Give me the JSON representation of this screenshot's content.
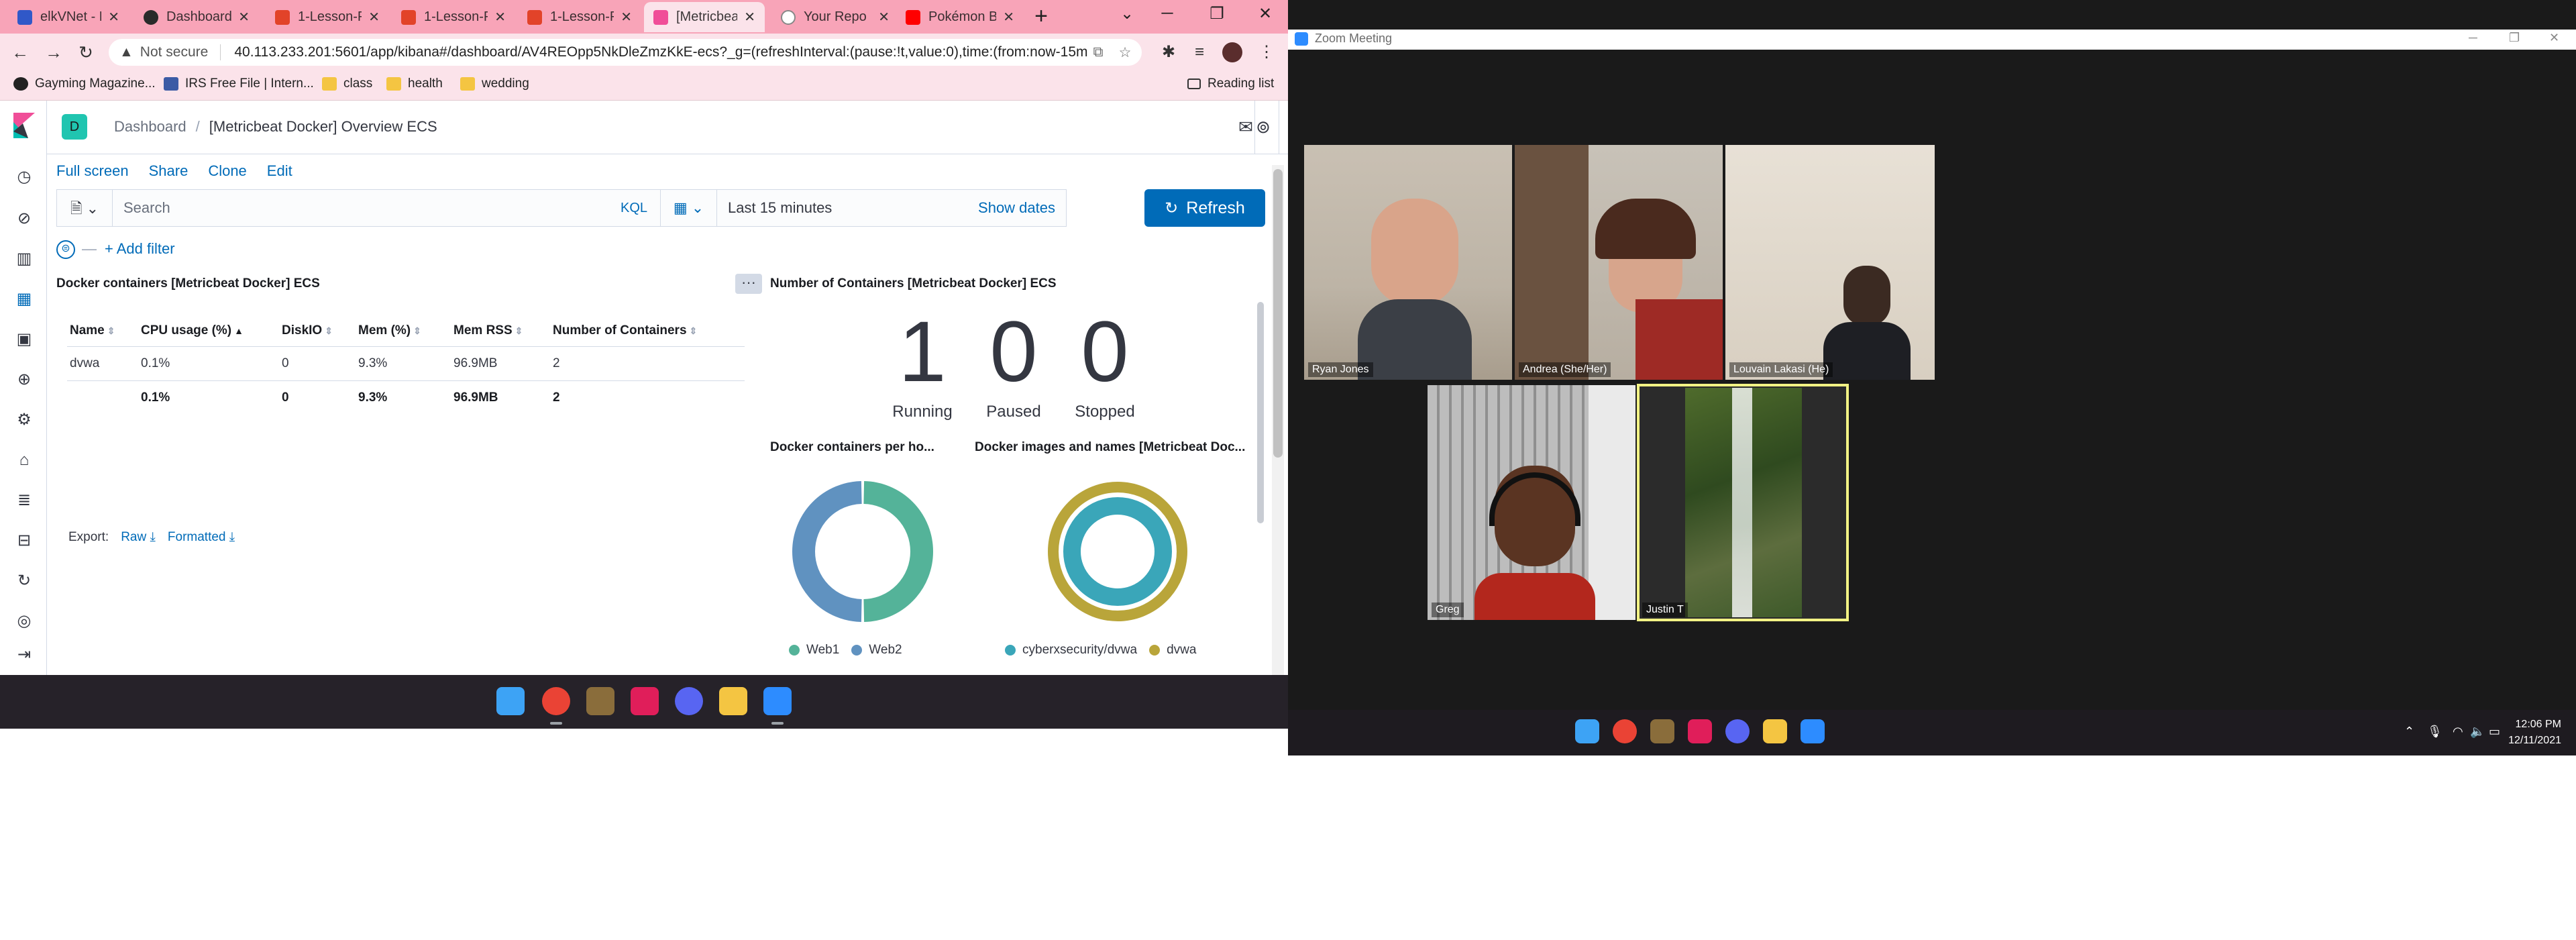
{
  "browser": {
    "tabs": [
      {
        "label": "elkVNet - M",
        "color": "#3058c8"
      },
      {
        "label": "Dashboard",
        "color": "#2a2a2a"
      },
      {
        "label": "1-Lesson-P",
        "color": "#e24329"
      },
      {
        "label": "1-Lesson-P",
        "color": "#e24329"
      },
      {
        "label": "1-Lesson-P",
        "color": "#e24329"
      },
      {
        "label": "[Metricbeat",
        "color": "#f04e98"
      },
      {
        "label": "Your Repo",
        "color": "#888888"
      },
      {
        "label": "Pokémon B",
        "color": "#ff0000"
      }
    ],
    "new_tab": "+",
    "address": {
      "not_secure": "Not secure",
      "url": "40.113.233.201:5601/app/kibana#/dashboard/AV4REOpp5NkDleZmzKkE-ecs?_g=(refreshInterval:(pause:!t,value:0),time:(from:now-15m,..."
    },
    "bookmarks": [
      {
        "label": "Gayming Magazine..."
      },
      {
        "label": "IRS Free File | Intern..."
      },
      {
        "label": "class"
      },
      {
        "label": "health"
      },
      {
        "label": "wedding"
      }
    ],
    "reading_list": "Reading list"
  },
  "kibana": {
    "space_badge": "D",
    "breadcrumbs": [
      "Dashboard",
      "[Metricbeat Docker] Overview ECS"
    ],
    "top_nav": [
      "Full screen",
      "Share",
      "Clone",
      "Edit"
    ],
    "search": {
      "placeholder": "Search",
      "language": "KQL"
    },
    "date": {
      "value": "Last 15 minutes",
      "show_dates": "Show dates"
    },
    "refresh_label": "Refresh",
    "add_filter": "+ Add filter",
    "containers_panel": {
      "title": "Docker containers [Metricbeat Docker] ECS",
      "columns": [
        "Name",
        "CPU usage (%)",
        "DiskIO",
        "Mem (%)",
        "Mem RSS",
        "Number of Containers"
      ],
      "rows": [
        [
          "dvwa",
          "0.1%",
          "0",
          "9.3%",
          "96.9MB",
          "2"
        ]
      ],
      "totals": [
        "",
        "0.1%",
        "0",
        "9.3%",
        "96.9MB",
        "2"
      ],
      "export_label": "Export:",
      "export_raw": "Raw",
      "export_formatted": "Formatted"
    },
    "count_panel": {
      "title": "Number of Containers [Metricbeat Docker] ECS",
      "metrics": [
        {
          "value": "1",
          "label": "Running"
        },
        {
          "value": "0",
          "label": "Paused"
        },
        {
          "value": "0",
          "label": "Stopped"
        }
      ]
    },
    "donut1": {
      "title": "Docker containers per ho...",
      "legend": [
        {
          "label": "Web1",
          "color": "#54b399"
        },
        {
          "label": "Web2",
          "color": "#6092c0"
        }
      ]
    },
    "donut2": {
      "title": "Docker images and names [Metricbeat Doc...",
      "legend": [
        {
          "label": "cyberxsecurity/dvwa",
          "color": "#3aa6b9"
        },
        {
          "label": "dvwa",
          "color": "#b9a53a"
        }
      ]
    }
  },
  "chart_data": [
    {
      "type": "pie",
      "title": "Docker containers per ho...",
      "categories": [
        "Web1",
        "Web2"
      ],
      "values": [
        50,
        50
      ],
      "colors": [
        "#54b399",
        "#6092c0"
      ]
    },
    {
      "type": "pie",
      "title": "Docker images and names [Metricbeat Doc...",
      "categories": [
        "cyberxsecurity/dvwa",
        "dvwa"
      ],
      "values": [
        100,
        100
      ],
      "colors": [
        "#3aa6b9",
        "#b9a53a"
      ]
    }
  ],
  "zoom": {
    "title": "Zoom Meeting",
    "participants": [
      {
        "name": "Ryan Jones"
      },
      {
        "name": "Andrea (She/Her)"
      },
      {
        "name": "Louvain Lakasi (He)"
      },
      {
        "name": "Greg"
      },
      {
        "name": "Justin T"
      }
    ],
    "active_speaker": "Justin T"
  },
  "taskbar": {
    "time": "12:06 PM",
    "date": "12/11/2021"
  }
}
